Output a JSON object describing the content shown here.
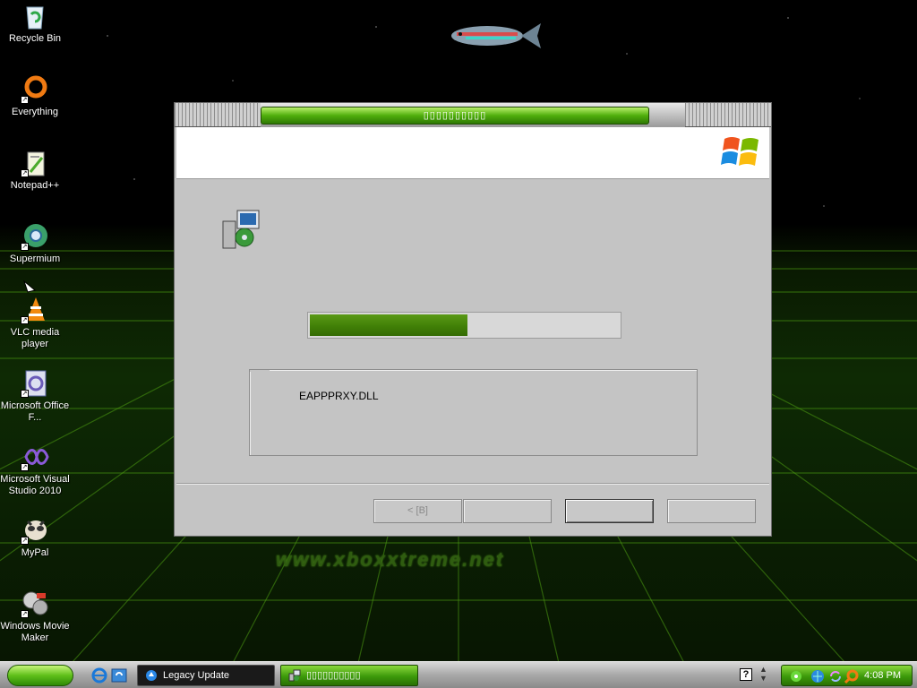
{
  "desktop": {
    "icons": [
      {
        "label": "Recycle Bin",
        "icon": "recycle-bin-icon"
      },
      {
        "label": "Everything",
        "icon": "everything-search-icon"
      },
      {
        "label": "Notepad++",
        "icon": "notepad-plus-plus-icon"
      },
      {
        "label": "Supermium",
        "icon": "supermium-browser-icon"
      },
      {
        "label": "VLC media player",
        "icon": "vlc-cone-icon"
      },
      {
        "label": "Microsoft Office F...",
        "icon": "office-file-icon"
      },
      {
        "label": "Microsoft Visual Studio 2010",
        "icon": "visual-studio-icon"
      },
      {
        "label": "MyPal",
        "icon": "mypal-browser-icon"
      },
      {
        "label": "Windows Movie Maker",
        "icon": "movie-maker-icon"
      }
    ],
    "watermark": "www.xboxxtreme.net"
  },
  "dialog": {
    "title": "▯▯▯▯▯▯▯▯▯▯",
    "progress_fraction": 0.51,
    "current_file": "EAPPPRXY.DLL",
    "buttons": {
      "back": "<  [B]",
      "next": "",
      "primary": "",
      "cancel": ""
    }
  },
  "taskbar": {
    "tasks": [
      {
        "label": "Legacy Update",
        "icon": "legacy-update-icon"
      },
      {
        "label": "▯▯▯▯▯▯▯▯▯▯",
        "icon": "setup-icon"
      }
    ],
    "help_glyph": "?",
    "clock": "4:08 PM"
  },
  "colors": {
    "accent_green": "#4fae0c",
    "progress_green": "#3f7d06",
    "dialog_gray": "#c4c4c4"
  }
}
